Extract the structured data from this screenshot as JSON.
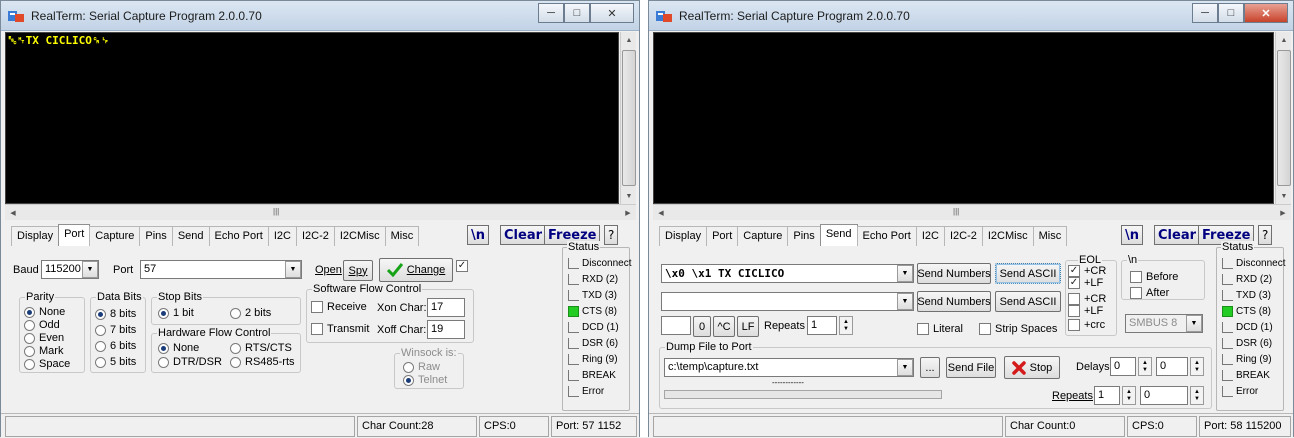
{
  "left": {
    "title": "RealTerm: Serial Capture Program 2.0.0.70",
    "terminal_text": "␛␉TX CICLICO␍␊",
    "tabs": [
      "Display",
      "Port",
      "Capture",
      "Pins",
      "Send",
      "Echo Port",
      "I2C",
      "I2C-2",
      "I2CMisc",
      "Misc"
    ],
    "active_tab": "Port",
    "newline_btn": "\\n",
    "clear_btn": "Clear",
    "freeze_btn": "Freeze",
    "help_btn": "?",
    "baud_label": "Baud",
    "baud_value": "115200",
    "port_label": "Port",
    "port_value": "57",
    "open_btn": "Open",
    "spy_btn": "Spy",
    "change_btn": "Change",
    "parity": {
      "legend": "Parity",
      "options": [
        "None",
        "Odd",
        "Even",
        "Mark",
        "Space"
      ],
      "selected": "None"
    },
    "databits": {
      "legend": "Data Bits",
      "options": [
        "8 bits",
        "7 bits",
        "6 bits",
        "5 bits"
      ],
      "selected": "8 bits"
    },
    "stopbits": {
      "legend": "Stop Bits",
      "options": [
        "1 bit",
        "2 bits"
      ],
      "selected": "1 bit"
    },
    "hwflow": {
      "legend": "Hardware Flow Control",
      "options": [
        "None",
        "RTS/CTS",
        "DTR/DSR",
        "RS485-rts"
      ],
      "selected": "None"
    },
    "swflow": {
      "legend": "Software Flow Control",
      "receive": "Receive",
      "transmit": "Transmit",
      "xon_label": "Xon Char:",
      "xon_value": "17",
      "xoff_label": "Xoff Char:",
      "xoff_value": "19"
    },
    "winsock": {
      "legend": "Winsock is:",
      "options": [
        "Raw",
        "Telnet"
      ],
      "selected": "Telnet"
    },
    "status": {
      "legend": "Status",
      "items": [
        {
          "label": "Disconnect",
          "on": false
        },
        {
          "label": "RXD (2)",
          "on": false
        },
        {
          "label": "TXD (3)",
          "on": false
        },
        {
          "label": "CTS (8)",
          "on": true
        },
        {
          "label": "DCD (1)",
          "on": false
        },
        {
          "label": "DSR (6)",
          "on": false
        },
        {
          "label": "Ring (9)",
          "on": false
        },
        {
          "label": "BREAK",
          "on": false
        },
        {
          "label": "Error",
          "on": false
        }
      ]
    },
    "statusbar": {
      "char_count": "Char Count:28",
      "cps": "CPS:0",
      "port": "Port: 57 1152"
    }
  },
  "right": {
    "title": "RealTerm: Serial Capture Program 2.0.0.70",
    "tabs": [
      "Display",
      "Port",
      "Capture",
      "Pins",
      "Send",
      "Echo Port",
      "I2C",
      "I2C-2",
      "I2CMisc",
      "Misc"
    ],
    "active_tab": "Send",
    "newline_btn": "\\n",
    "clear_btn": "Clear",
    "freeze_btn": "Freeze",
    "help_btn": "?",
    "send_text_1": "\\x0 \\x1 TX CICLICO",
    "send_text_2": "",
    "send_numbers_btn": "Send Numbers",
    "send_ascii_btn": "Send ASCII",
    "zero_btn": "0",
    "ctrl_c_btn": "^C",
    "lf_btn": "LF",
    "repeats_label": "Repeats",
    "repeats_value": "1",
    "literal_label": "Literal",
    "strip_spaces_label": "Strip Spaces",
    "eol": {
      "legend": "EOL",
      "row1": [
        "+CR",
        "+LF"
      ],
      "row2": [
        "+CR",
        "+LF",
        "+crc"
      ]
    },
    "nl_group": {
      "legend": "\\n",
      "before": "Before",
      "after": "After"
    },
    "smbus_value": "SMBUS 8",
    "dump": {
      "legend": "Dump File to Port",
      "file": "c:\\temp\\capture.txt",
      "browse_btn": "...",
      "send_file_btn": "Send File",
      "stop_btn": "Stop",
      "delays_label": "Delays",
      "delay1": "0",
      "delay2": "0",
      "repeats_label": "Repeats",
      "repeats1": "1",
      "repeats2": "0",
      "progress_text": "------------"
    },
    "status": {
      "legend": "Status",
      "items": [
        {
          "label": "Disconnect",
          "on": false
        },
        {
          "label": "RXD (2)",
          "on": false
        },
        {
          "label": "TXD (3)",
          "on": false
        },
        {
          "label": "CTS (8)",
          "on": true
        },
        {
          "label": "DCD (1)",
          "on": false
        },
        {
          "label": "DSR (6)",
          "on": false
        },
        {
          "label": "Ring (9)",
          "on": false
        },
        {
          "label": "BREAK",
          "on": false
        },
        {
          "label": "Error",
          "on": false
        }
      ]
    },
    "statusbar": {
      "char_count": "Char Count:0",
      "cps": "CPS:0",
      "port": "Port: 58 115200"
    }
  }
}
